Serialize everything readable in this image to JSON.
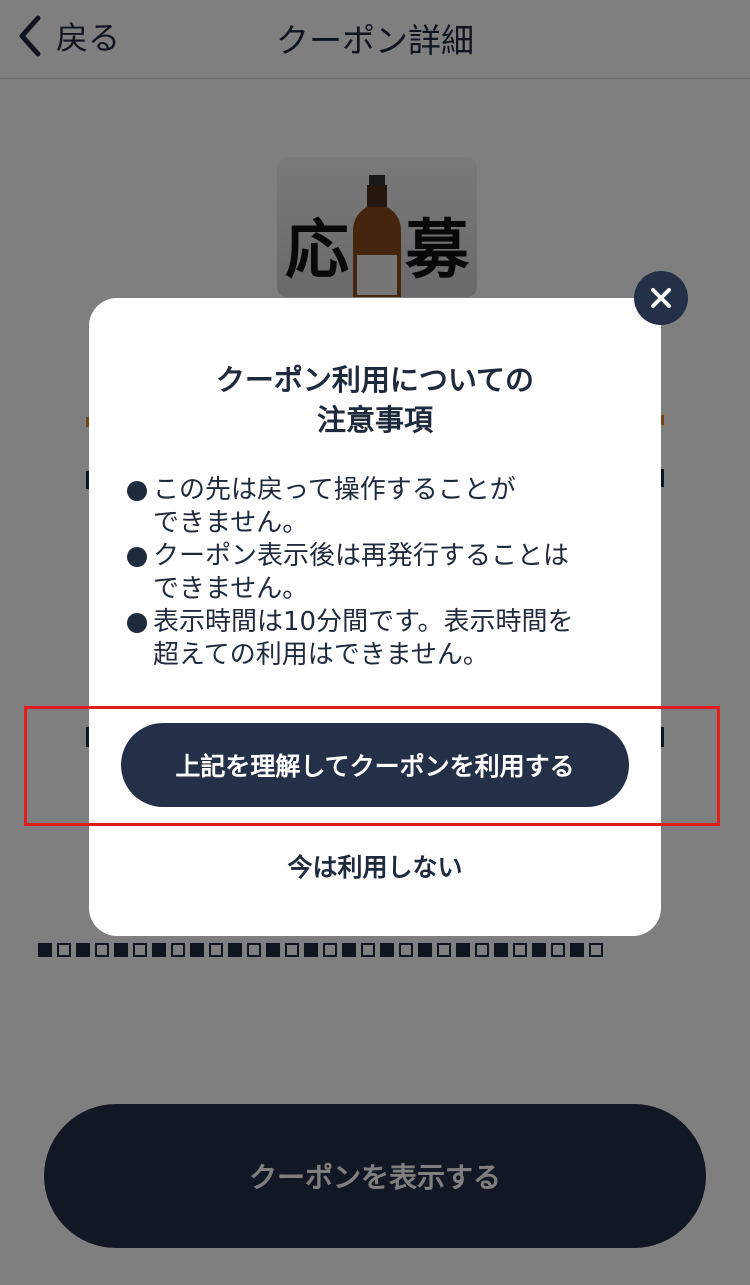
{
  "header": {
    "back_label": "戻る",
    "title": "クーポン詳細"
  },
  "coupon": {
    "thumbnail_text_left": "応",
    "thumbnail_text_right": "募",
    "show_button_label": "クーポンを表示する"
  },
  "modal": {
    "title": "クーポン利用についての\n注意事項",
    "notes": [
      "この先は戻って操作することが\nできません。",
      "クーポン表示後は再発行することは\nできません。",
      "表示時間は10分間です。表示時間を\n超えての利用はできません。"
    ],
    "agree_button_label": "上記を理解してクーポンを利用する",
    "decline_label": "今は利用しない"
  },
  "colors": {
    "primary": "#243047",
    "highlight": "#e01c1c",
    "overlay": "rgba(0,0,0,0.5)"
  },
  "icons": {
    "back": "chevron-left-icon",
    "close": "close-icon"
  }
}
